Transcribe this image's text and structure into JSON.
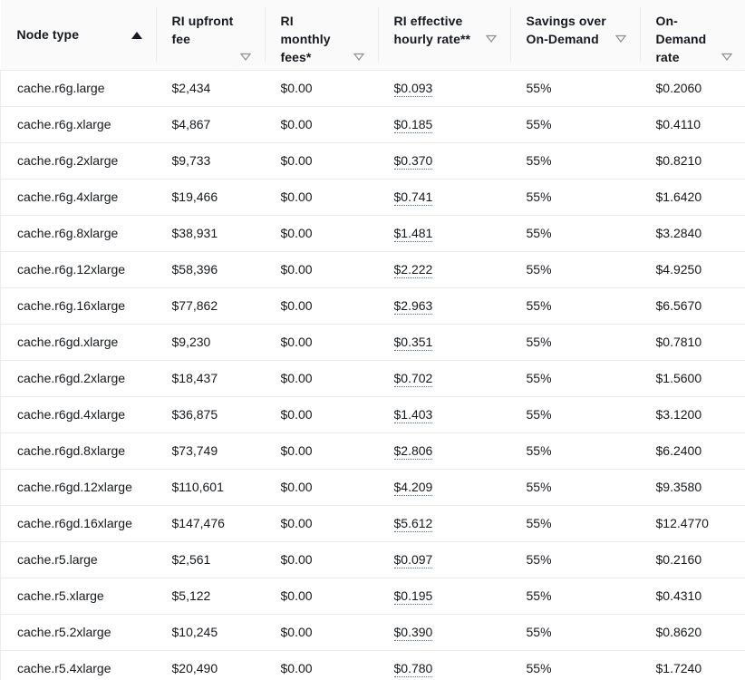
{
  "table": {
    "columns": [
      {
        "id": "node_type",
        "label": "Node type",
        "sort_state": "ascending",
        "sort_icon": "sort-ascending-icon",
        "lines": 1
      },
      {
        "id": "ri_upfront_fee",
        "label": "RI upfront fee",
        "sort_state": "none",
        "sort_icon": "sort-inactive-icon",
        "lines": 3
      },
      {
        "id": "ri_monthly_fees",
        "label": "RI monthly fees*",
        "sort_state": "none",
        "sort_icon": "sort-inactive-icon",
        "lines": 3
      },
      {
        "id": "ri_effective_rate",
        "label": "RI effective hourly rate**",
        "sort_state": "none",
        "sort_icon": "sort-inactive-icon",
        "lines": 2
      },
      {
        "id": "savings",
        "label": "Savings over On-Demand",
        "sort_state": "none",
        "sort_icon": "sort-inactive-icon",
        "lines": 2
      },
      {
        "id": "on_demand_rate",
        "label": "On-Demand rate",
        "sort_state": "none",
        "sort_icon": "sort-inactive-icon",
        "lines": 3
      }
    ],
    "rows": [
      {
        "node_type": "cache.r6g.large",
        "ri_upfront_fee": "$2,434",
        "ri_monthly_fees": "$0.00",
        "ri_effective_rate": "$0.093",
        "savings": "55%",
        "on_demand_rate": "$0.2060"
      },
      {
        "node_type": "cache.r6g.xlarge",
        "ri_upfront_fee": "$4,867",
        "ri_monthly_fees": "$0.00",
        "ri_effective_rate": "$0.185",
        "savings": "55%",
        "on_demand_rate": "$0.4110"
      },
      {
        "node_type": "cache.r6g.2xlarge",
        "ri_upfront_fee": "$9,733",
        "ri_monthly_fees": "$0.00",
        "ri_effective_rate": "$0.370",
        "savings": "55%",
        "on_demand_rate": "$0.8210"
      },
      {
        "node_type": "cache.r6g.4xlarge",
        "ri_upfront_fee": "$19,466",
        "ri_monthly_fees": "$0.00",
        "ri_effective_rate": "$0.741",
        "savings": "55%",
        "on_demand_rate": "$1.6420"
      },
      {
        "node_type": "cache.r6g.8xlarge",
        "ri_upfront_fee": "$38,931",
        "ri_monthly_fees": "$0.00",
        "ri_effective_rate": "$1.481",
        "savings": "55%",
        "on_demand_rate": "$3.2840"
      },
      {
        "node_type": "cache.r6g.12xlarge",
        "ri_upfront_fee": "$58,396",
        "ri_monthly_fees": "$0.00",
        "ri_effective_rate": "$2.222",
        "savings": "55%",
        "on_demand_rate": "$4.9250"
      },
      {
        "node_type": "cache.r6g.16xlarge",
        "ri_upfront_fee": "$77,862",
        "ri_monthly_fees": "$0.00",
        "ri_effective_rate": "$2.963",
        "savings": "55%",
        "on_demand_rate": "$6.5670"
      },
      {
        "node_type": "cache.r6gd.xlarge",
        "ri_upfront_fee": "$9,230",
        "ri_monthly_fees": "$0.00",
        "ri_effective_rate": "$0.351",
        "savings": "55%",
        "on_demand_rate": "$0.7810"
      },
      {
        "node_type": "cache.r6gd.2xlarge",
        "ri_upfront_fee": "$18,437",
        "ri_monthly_fees": "$0.00",
        "ri_effective_rate": "$0.702",
        "savings": "55%",
        "on_demand_rate": "$1.5600"
      },
      {
        "node_type": "cache.r6gd.4xlarge",
        "ri_upfront_fee": "$36,875",
        "ri_monthly_fees": "$0.00",
        "ri_effective_rate": "$1.403",
        "savings": "55%",
        "on_demand_rate": "$3.1200"
      },
      {
        "node_type": "cache.r6gd.8xlarge",
        "ri_upfront_fee": "$73,749",
        "ri_monthly_fees": "$0.00",
        "ri_effective_rate": "$2.806",
        "savings": "55%",
        "on_demand_rate": "$6.2400"
      },
      {
        "node_type": "cache.r6gd.12xlarge",
        "ri_upfront_fee": "$110,601",
        "ri_monthly_fees": "$0.00",
        "ri_effective_rate": "$4.209",
        "savings": "55%",
        "on_demand_rate": "$9.3580"
      },
      {
        "node_type": "cache.r6gd.16xlarge",
        "ri_upfront_fee": "$147,476",
        "ri_monthly_fees": "$0.00",
        "ri_effective_rate": "$5.612",
        "savings": "55%",
        "on_demand_rate": "$12.4770"
      },
      {
        "node_type": "cache.r5.large",
        "ri_upfront_fee": "$2,561",
        "ri_monthly_fees": "$0.00",
        "ri_effective_rate": "$0.097",
        "savings": "55%",
        "on_demand_rate": "$0.2160"
      },
      {
        "node_type": "cache.r5.xlarge",
        "ri_upfront_fee": "$5,122",
        "ri_monthly_fees": "$0.00",
        "ri_effective_rate": "$0.195",
        "savings": "55%",
        "on_demand_rate": "$0.4310"
      },
      {
        "node_type": "cache.r5.2xlarge",
        "ri_upfront_fee": "$10,245",
        "ri_monthly_fees": "$0.00",
        "ri_effective_rate": "$0.390",
        "savings": "55%",
        "on_demand_rate": "$0.8620"
      },
      {
        "node_type": "cache.r5.4xlarge",
        "ri_upfront_fee": "$20,490",
        "ri_monthly_fees": "$0.00",
        "ri_effective_rate": "$0.780",
        "savings": "55%",
        "on_demand_rate": "$1.7240"
      }
    ]
  },
  "colors": {
    "header_background": "#fafafa",
    "header_text": "#16191f",
    "body_text": "#16191f",
    "row_border": "#eaeded",
    "divider": "#e9ebed",
    "dotted_underline": "#687078"
  }
}
